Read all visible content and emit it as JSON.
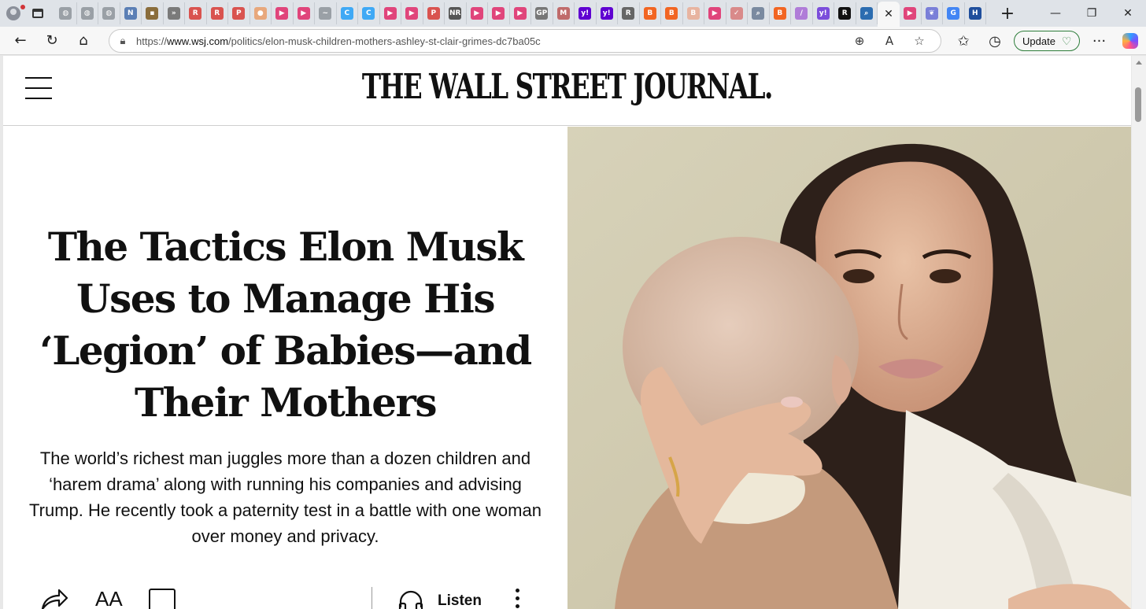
{
  "browser": {
    "tabs": [
      {
        "icon": "globe-icon",
        "color": "#9aa0a6",
        "glyph": "◍"
      },
      {
        "icon": "globe-icon",
        "color": "#9aa0a6",
        "glyph": "◍"
      },
      {
        "icon": "globe-icon",
        "color": "#9aa0a6",
        "glyph": "◍"
      },
      {
        "icon": "news-icon",
        "color": "#5b7fb5",
        "glyph": "N"
      },
      {
        "icon": "doc-icon",
        "color": "#8a6d3b",
        "glyph": "▪"
      },
      {
        "icon": "arrow-icon",
        "color": "#7a7a7a",
        "glyph": "»"
      },
      {
        "icon": "r-icon",
        "color": "#d9534f",
        "glyph": "R"
      },
      {
        "icon": "r-icon",
        "color": "#d9534f",
        "glyph": "R"
      },
      {
        "icon": "pdf-icon",
        "color": "#d9534f",
        "glyph": "P"
      },
      {
        "icon": "circle-icon",
        "color": "#e8a87c",
        "glyph": "●"
      },
      {
        "icon": "video-icon",
        "color": "#e0457b",
        "glyph": "▶"
      },
      {
        "icon": "video-icon",
        "color": "#e0457b",
        "glyph": "▶"
      },
      {
        "icon": "bird-icon",
        "color": "#9aa0a6",
        "glyph": "~"
      },
      {
        "icon": "c-icon",
        "color": "#3fa9f5",
        "glyph": "C"
      },
      {
        "icon": "c-icon",
        "color": "#3fa9f5",
        "glyph": "C"
      },
      {
        "icon": "video-icon",
        "color": "#e0457b",
        "glyph": "▶"
      },
      {
        "icon": "video-icon",
        "color": "#e0457b",
        "glyph": "▶"
      },
      {
        "icon": "pdf-icon",
        "color": "#d9534f",
        "glyph": "P"
      },
      {
        "icon": "nr-icon",
        "color": "#555555",
        "glyph": "NR"
      },
      {
        "icon": "video-icon",
        "color": "#e0457b",
        "glyph": "▶"
      },
      {
        "icon": "video-icon",
        "color": "#e0457b",
        "glyph": "▶"
      },
      {
        "icon": "video-icon",
        "color": "#e0457b",
        "glyph": "▶"
      },
      {
        "icon": "gp-icon",
        "color": "#777777",
        "glyph": "GP"
      },
      {
        "icon": "m-icon",
        "color": "#c06b6b",
        "glyph": "M"
      },
      {
        "icon": "yahoo-icon",
        "color": "#5f01d1",
        "glyph": "y!"
      },
      {
        "icon": "yahoo-icon",
        "color": "#5f01d1",
        "glyph": "y!"
      },
      {
        "icon": "r-icon",
        "color": "#666666",
        "glyph": "R"
      },
      {
        "icon": "rss-icon",
        "color": "#f26522",
        "glyph": "B"
      },
      {
        "icon": "rss-icon",
        "color": "#f26522",
        "glyph": "B"
      },
      {
        "icon": "b-icon",
        "color": "#e8b4a0",
        "glyph": "B"
      },
      {
        "icon": "video-icon",
        "color": "#e0457b",
        "glyph": "▶"
      },
      {
        "icon": "check-icon",
        "color": "#d98a8a",
        "glyph": "✓"
      },
      {
        "icon": "search-icon",
        "color": "#7a8aa0",
        "glyph": "⌕"
      },
      {
        "icon": "rss-icon",
        "color": "#f26522",
        "glyph": "B"
      },
      {
        "icon": "pen-icon",
        "color": "#b07cd8",
        "glyph": "/"
      },
      {
        "icon": "yahoo-icon",
        "color": "#7b4ddb",
        "glyph": "y!"
      },
      {
        "icon": "r-icon",
        "color": "#111111",
        "glyph": "R"
      },
      {
        "icon": "search-icon",
        "color": "#2b6cb0",
        "glyph": "⌕"
      }
    ],
    "active_tab_close": "✕",
    "tabs_after": [
      {
        "icon": "video-icon",
        "color": "#e0457b",
        "glyph": "▶"
      },
      {
        "icon": "butterfly-icon",
        "color": "#7a7fd8",
        "glyph": "❦"
      },
      {
        "icon": "g-icon",
        "color": "#4285f4",
        "glyph": "G"
      },
      {
        "icon": "h-icon",
        "color": "#1f4e9c",
        "glyph": "H"
      }
    ],
    "new_tab": "+",
    "url_prefix": "https://",
    "url_host": "www.wsj.com",
    "url_path": "/politics/elon-musk-children-mothers-ashley-st-clair-grimes-dc7ba05c",
    "update_label": "Update"
  },
  "page": {
    "masthead": "THE WALL STREET JOURNAL.",
    "headline": "The Tactics Elon Musk Uses to Manage His ‘Legion’ of Babies—and Their Mothers",
    "dek": "The world’s richest man juggles more than a dozen children and ‘harem drama’ along with running his companies and advising Trump. He recently took a paternity test in a battle with one woman over money and privacy.",
    "text_size_glyph": "AA",
    "listen_label": "Listen"
  }
}
